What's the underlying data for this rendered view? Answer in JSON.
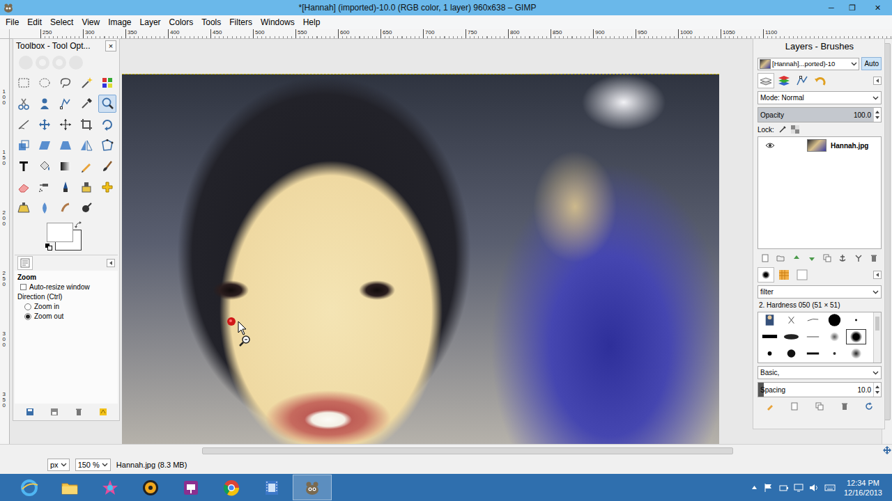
{
  "window": {
    "title": "*[Hannah] (imported)-10.0 (RGB color, 1 layer) 960x638 – GIMP",
    "controls": [
      "─",
      "❐",
      "✕"
    ]
  },
  "menu": [
    "File",
    "Edit",
    "Select",
    "View",
    "Image",
    "Layer",
    "Colors",
    "Tools",
    "Filters",
    "Windows",
    "Help"
  ],
  "rulers": {
    "top": [
      "250",
      "300",
      "350",
      "400",
      "450",
      "500",
      "550",
      "600",
      "650",
      "700",
      "750",
      "800",
      "850",
      "900",
      "950",
      "1000",
      "1050",
      "1100"
    ],
    "left": [
      "100",
      "150",
      "200",
      "250",
      "300",
      "350"
    ]
  },
  "toolbox": {
    "title": "Toolbox - Tool Opt...",
    "close": "×",
    "tools": [
      {
        "selected": false
      },
      {
        "selected": false
      },
      {
        "selected": false
      },
      {
        "selected": false
      },
      {
        "selected": false
      },
      {
        "selected": false
      },
      {
        "selected": false
      },
      {
        "selected": false
      },
      {
        "selected": false
      },
      {
        "selected": true
      },
      {
        "selected": false
      },
      {
        "selected": false
      },
      {
        "selected": false
      },
      {
        "selected": false
      },
      {
        "selected": false
      },
      {
        "selected": false
      },
      {
        "selected": false
      },
      {
        "selected": false
      },
      {
        "selected": false
      },
      {
        "selected": false
      },
      {
        "selected": false
      },
      {
        "selected": false
      },
      {
        "selected": false
      },
      {
        "selected": false
      },
      {
        "selected": false
      },
      {
        "selected": false
      },
      {
        "selected": false
      },
      {
        "selected": false
      },
      {
        "selected": false
      },
      {
        "selected": false
      },
      {
        "selected": false
      },
      {
        "selected": false
      },
      {
        "selected": false
      },
      {
        "selected": false
      }
    ],
    "options": {
      "title": "Zoom",
      "auto_resize": {
        "label": "Auto-resize window",
        "checked": false
      },
      "direction": "Direction (Ctrl)",
      "directions": [
        {
          "label": "Zoom in",
          "selected": false
        },
        {
          "label": "Zoom out",
          "selected": true
        }
      ]
    }
  },
  "dock": {
    "title": "Layers - Brushes",
    "image": "[Hannah]...ported)-10",
    "auto": "Auto",
    "tabs": [
      {
        "selected": true
      },
      {
        "selected": false
      },
      {
        "selected": false
      },
      {
        "selected": false
      }
    ],
    "mode": "Mode: Normal",
    "opacity": {
      "label": "Opacity",
      "value": "100.0",
      "level": 1
    },
    "lock": "Lock:",
    "layers": [
      {
        "name": "Hannah.jpg",
        "visible": true,
        "selected": false
      }
    ],
    "brush_tabs": [
      {
        "selected": true
      },
      {
        "selected": false
      },
      {
        "selected": false
      }
    ],
    "filter": "filter",
    "brush_name": "2. Hardness 050 (51 × 51)",
    "brushes": [
      {
        "selected": false
      },
      {
        "selected": false
      },
      {
        "selected": false
      },
      {
        "selected": false
      },
      {
        "selected": false
      },
      {
        "selected": false
      },
      {
        "selected": false
      },
      {
        "selected": false
      },
      {
        "selected": false
      },
      {
        "selected": true
      },
      {
        "selected": false
      },
      {
        "selected": false
      },
      {
        "selected": false
      },
      {
        "selected": false
      },
      {
        "selected": false
      }
    ],
    "tag": "Basic,",
    "spacing": {
      "label": "Spacing",
      "value": "10.0",
      "level": 0.05
    }
  },
  "status_bar": {
    "unit": "px",
    "zoom": "150 %",
    "file": "Hannah.jpg (8.3 MB)"
  },
  "taskbar": {
    "apps": [
      {
        "selected": false
      },
      {
        "selected": false
      },
      {
        "selected": false
      },
      {
        "selected": false
      },
      {
        "selected": false
      },
      {
        "selected": false
      },
      {
        "selected": false
      },
      {
        "selected": true
      }
    ],
    "time": "12:34 PM",
    "date": "12/16/2013"
  }
}
